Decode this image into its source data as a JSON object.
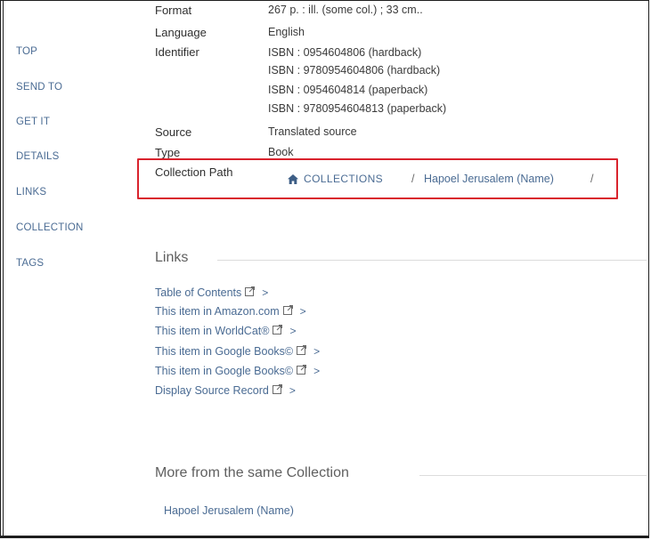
{
  "nav": {
    "items": [
      {
        "label": "TOP"
      },
      {
        "label": "SEND TO"
      },
      {
        "label": "GET IT"
      },
      {
        "label": "DETAILS"
      },
      {
        "label": "LINKS"
      },
      {
        "label": "COLLECTION"
      },
      {
        "label": "TAGS"
      }
    ]
  },
  "details": {
    "format_label": "Format",
    "format_value": "267 p. : ill. (some col.) ; 33 cm..",
    "language_label": "Language",
    "language_value": "English",
    "identifier_label": "Identifier",
    "identifiers": [
      "ISBN : 0954604806 (hardback)",
      "ISBN : 9780954604806 (hardback)",
      "ISBN : 0954604814 (paperback)",
      "ISBN : 9780954604813 (paperback)"
    ],
    "source_label": "Source",
    "source_value": "Translated source",
    "type_label": "Type",
    "type_value": "Book",
    "collection_path_label": "Collection Path",
    "collection_home": "COLLECTIONS",
    "collection_separator": "/",
    "collection_item": "Hapoel Jerusalem (Name)"
  },
  "links": {
    "title": "Links",
    "items": [
      {
        "label": "Table of Contents"
      },
      {
        "label": "This item in Amazon.com"
      },
      {
        "label": "This item in WorldCat®"
      },
      {
        "label": "This item in Google Books©"
      },
      {
        "label": "This item in Google Books©"
      },
      {
        "label": "Display Source Record"
      }
    ],
    "chevron": ">"
  },
  "collection": {
    "title": "More from the same Collection",
    "item": "Hapoel Jerusalem (Name)"
  },
  "colors": {
    "accent": "#4a6b93",
    "highlight": "#d9232d"
  },
  "icons": {
    "home": "home-icon",
    "external": "external-link-icon"
  }
}
